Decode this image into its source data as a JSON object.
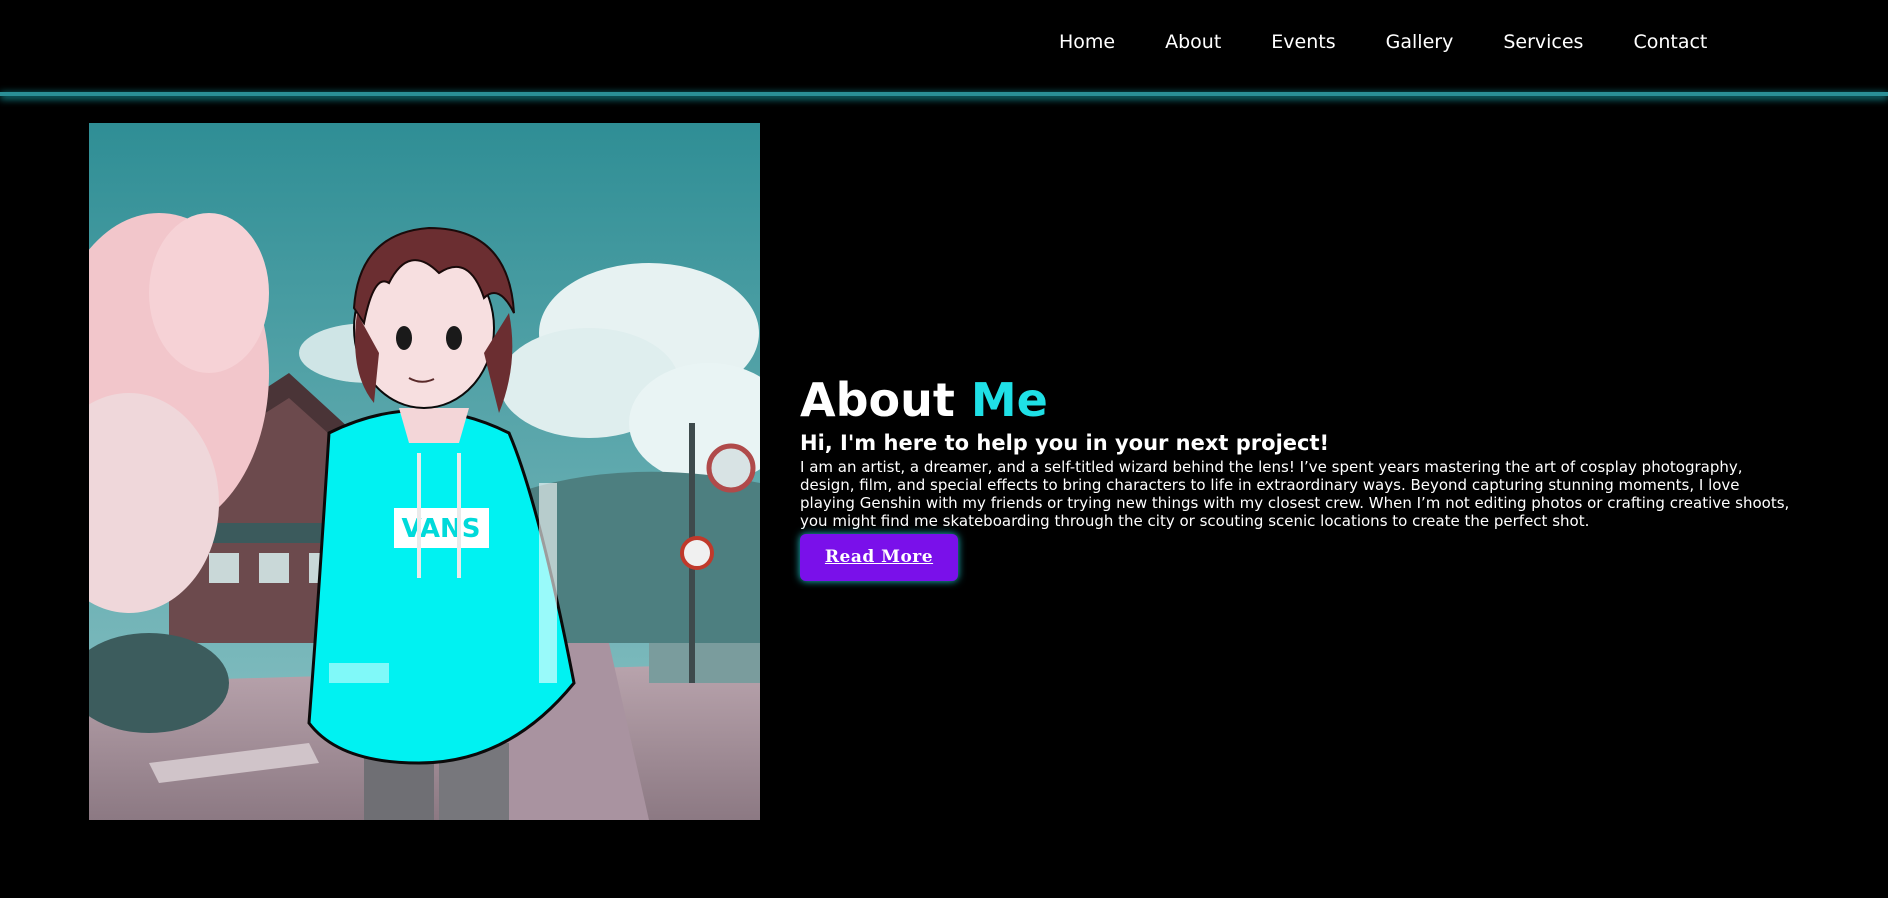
{
  "nav": {
    "items": [
      "Home",
      "About",
      "Events",
      "Gallery",
      "Services",
      "Contact"
    ]
  },
  "hero": {
    "image_alt": "Anime-style illustration of a brown-haired boy in a cyan VANS hoodie standing on a street with cherry blossoms",
    "hoodie_text": "VANS"
  },
  "about": {
    "title_main": "About",
    "title_accent": "Me",
    "subtitle": "Hi, I'm here to help you in your next project!",
    "body": "I am an artist, a dreamer, and a self-titled wizard behind the lens! I’ve spent years mastering the art of cosplay photography, design, film, and special effects to bring characters to life in extraordinary ways. Beyond capturing stunning moments, I love playing Genshin with my friends or trying new things with my closest crew. When I’m not editing photos or crafting creative shoots, you might find me skateboarding through the city or scouting scenic locations to create the perfect shot.",
    "button_label": "Read More"
  },
  "colors": {
    "background": "#000000",
    "accent": "#1fe0e6",
    "button": "#7a10ea",
    "divider": "#2a8f96"
  }
}
